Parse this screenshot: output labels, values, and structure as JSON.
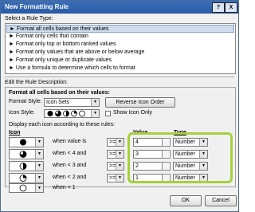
{
  "window": {
    "title": "New Formatting Rule",
    "help_label": "?",
    "close_label": "X"
  },
  "rule_type": {
    "label": "Select a Rule Type:",
    "items": [
      "► Format all cells based on their values",
      "► Format only cells that contain",
      "► Format only top or bottom ranked values",
      "► Format only values that are above or below average",
      "► Format only unique or duplicate values",
      "► Use a formula to determine which cells to format"
    ],
    "selected_index": 0
  },
  "description": {
    "label": "Edit the Rule Description:",
    "section_title": "Format all cells based on their values:",
    "format_style_label": "Format Style:",
    "format_style_value": "Icon Sets",
    "reverse_button": "Reverse Icon Order",
    "icon_style_label": "Icon Style:",
    "show_icon_only_label": "Show Icon Only",
    "display_rules_label": "Display each icon according to these rules:",
    "col_icon": "Icon",
    "col_value": "Value",
    "col_type": "Type",
    "rows": [
      {
        "icon": "full-moon",
        "condition": "when value is",
        "op": ">=",
        "value": "4",
        "type": "Number"
      },
      {
        "icon": "three-quarter-moon",
        "condition": "when < 4 and",
        "op": ">=",
        "value": "3",
        "type": "Number"
      },
      {
        "icon": "half-moon",
        "condition": "when < 3 and",
        "op": ">=",
        "value": "2",
        "type": "Number"
      },
      {
        "icon": "quarter-moon",
        "condition": "when < 2 and",
        "op": ">=",
        "value": "1",
        "type": "Number"
      },
      {
        "icon": "empty-moon",
        "condition": "when < 1"
      }
    ]
  },
  "footer": {
    "ok": "OK",
    "cancel": "Cancel"
  },
  "colors": {
    "highlight": "#a6d13b",
    "title_bar": "#2a5aa6"
  }
}
